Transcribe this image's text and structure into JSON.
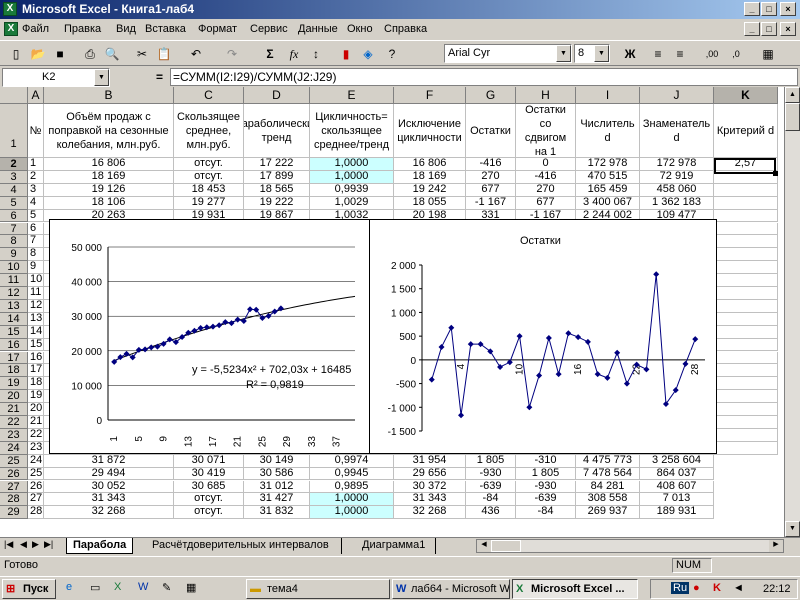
{
  "window": {
    "title": "Microsoft Excel - Книга1-лаб4"
  },
  "menu": [
    "Файл",
    "Правка",
    "Вид",
    "Вставка",
    "Формат",
    "Сервис",
    "Данные",
    "Окно",
    "Справка"
  ],
  "toolbar": {
    "font": "Arial Cyr",
    "size": "8",
    "bold": "Ж"
  },
  "formula": {
    "namebox": "K2",
    "eq": "=",
    "content": "=СУММ(I2:I29)/СУММ(J2:J29)"
  },
  "columns": [
    "A",
    "B",
    "C",
    "D",
    "E",
    "F",
    "G",
    "H",
    "I",
    "J",
    "K"
  ],
  "headers": [
    "№",
    "Объём продаж с поправкой на сезонные колебания, млн.руб.",
    "Скользящее среднее, млн.руб.",
    "Параболический тренд",
    "Цикличность= скользящее среднее/тренд",
    "Исключение цикличности",
    "Остатки",
    "Остатки со сдвигом на 1",
    "Числитель d",
    "Знаменатель d",
    "Критерий d"
  ],
  "rows_top": [
    [
      "1",
      "16 806",
      "отсут.",
      "17 222",
      "1,0000",
      "16 806",
      "-416",
      "0",
      "172 978",
      "172 978",
      "2,57"
    ],
    [
      "2",
      "18 169",
      "отсут.",
      "17 899",
      "1,0000",
      "18 169",
      "270",
      "-416",
      "470 515",
      "72 919",
      ""
    ],
    [
      "3",
      "19 126",
      "18 453",
      "18 565",
      "0,9939",
      "19 242",
      "677",
      "270",
      "165 459",
      "458 060",
      ""
    ],
    [
      "4",
      "18 106",
      "19 277",
      "19 222",
      "1,0029",
      "18 055",
      "-1 167",
      "677",
      "3 400 067",
      "1 362 183",
      ""
    ],
    [
      "5",
      "20 263",
      "19 931",
      "19 867",
      "1,0032",
      "20 198",
      "331",
      "-1 167",
      "2 244 002",
      "109 477",
      ""
    ]
  ],
  "rows_hidden_a": [
    "6",
    "7",
    "8",
    "9",
    "10",
    "11",
    "12",
    "13",
    "14",
    "15",
    "16",
    "17",
    "18",
    "19",
    "20",
    "21",
    "22",
    "23"
  ],
  "rows_bottom": [
    [
      "24",
      "31 872",
      "30 071",
      "30 149",
      "0,9974",
      "31 954",
      "1 805",
      "-310",
      "4 475 773",
      "3 258 604"
    ],
    [
      "25",
      "29 494",
      "30 419",
      "30 586",
      "0,9945",
      "29 656",
      "-930",
      "1 805",
      "7 478 564",
      "864 037"
    ],
    [
      "26",
      "30 052",
      "30 685",
      "31 012",
      "0,9895",
      "30 372",
      "-639",
      "-930",
      "84 281",
      "408 607"
    ],
    [
      "27",
      "31 343",
      "отсут.",
      "31 427",
      "1,0000",
      "31 343",
      "-84",
      "-639",
      "308 558",
      "7 013"
    ],
    [
      "28",
      "32 268",
      "отсут.",
      "31 832",
      "1,0000",
      "32 268",
      "436",
      "-84",
      "269 937",
      "189 931"
    ]
  ],
  "row_numbers": [
    "1",
    "2",
    "3",
    "4",
    "5",
    "6",
    "7",
    "8",
    "9",
    "10",
    "11",
    "12",
    "13",
    "14",
    "15",
    "16",
    "17",
    "18",
    "19",
    "20",
    "21",
    "22",
    "23",
    "24",
    "25",
    "26",
    "27",
    "28",
    "29"
  ],
  "chart_data": [
    {
      "type": "scatter",
      "title": "",
      "ylim": [
        0,
        50000
      ],
      "yticks": [
        "0",
        "10 000",
        "20 000",
        "30 000",
        "40 000",
        "50 000"
      ],
      "xticks": [
        "1",
        "5",
        "9",
        "13",
        "17",
        "21",
        "25",
        "29",
        "33",
        "37"
      ],
      "x": [
        1,
        2,
        3,
        4,
        5,
        6,
        7,
        8,
        9,
        10,
        11,
        12,
        13,
        14,
        15,
        16,
        17,
        18,
        19,
        20,
        21,
        22,
        23,
        24,
        25,
        26,
        27,
        28
      ],
      "y": [
        16806,
        18169,
        19126,
        18106,
        20263,
        20400,
        21000,
        21200,
        22000,
        23300,
        22500,
        24000,
        25200,
        25800,
        26600,
        26800,
        27000,
        27400,
        28300,
        28000,
        29000,
        28600,
        32000,
        31872,
        29494,
        30052,
        31343,
        32268
      ],
      "trend": {
        "a": -5.5234,
        "b": 702.03,
        "c": 16485,
        "xmax": 40
      },
      "equation": "y = -5,5234x² + 702,03x + 16485",
      "r2": "R² = 0,9819"
    },
    {
      "type": "line",
      "title": "Остатки",
      "ylim": [
        -1500,
        2000
      ],
      "yticks": [
        "-1 500",
        "-1 000",
        "-500",
        "0",
        "500",
        "1 000",
        "1 500",
        "2 000"
      ],
      "xticks": [
        "4",
        "10",
        "16",
        "22",
        "28"
      ],
      "x": [
        1,
        2,
        3,
        4,
        5,
        6,
        7,
        8,
        9,
        10,
        11,
        12,
        13,
        14,
        15,
        16,
        17,
        18,
        19,
        20,
        21,
        22,
        23,
        24,
        25,
        26,
        27,
        28
      ],
      "y": [
        -416,
        270,
        677,
        -1167,
        331,
        331,
        180,
        -150,
        -50,
        500,
        -1000,
        -330,
        460,
        -300,
        560,
        480,
        380,
        -300,
        -380,
        150,
        -500,
        -100,
        -200,
        1805,
        -930,
        -639,
        -84,
        436
      ]
    }
  ],
  "sheet_tabs": [
    "Парабола",
    "Расчётдоверительных интервалов",
    "Диаграмма1"
  ],
  "status": {
    "left": "Готово",
    "num": "NUM"
  },
  "taskbar": {
    "start": "Пуск",
    "items": [
      "тема4",
      "лаб64 - Microsoft Word",
      "Microsoft Excel ..."
    ],
    "lang": "Ru",
    "clock": "22:12"
  }
}
